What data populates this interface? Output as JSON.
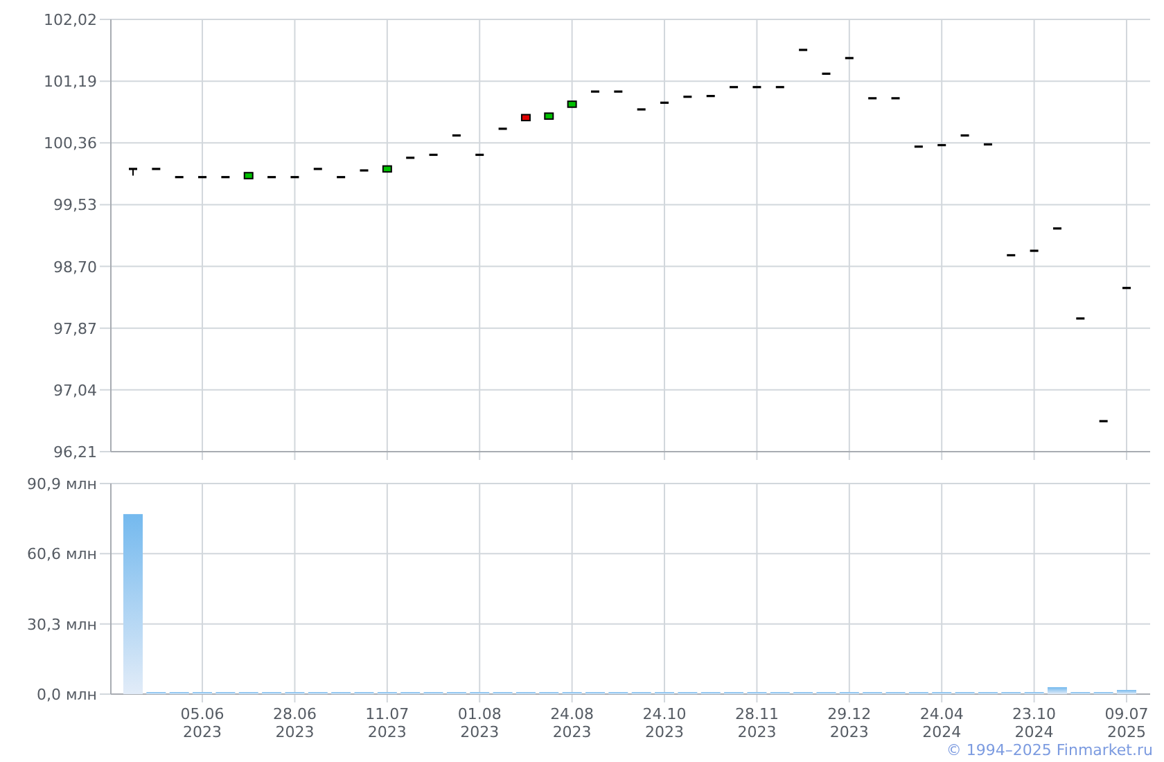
{
  "price_chart": {
    "chart_data": {
      "type": "candlestick",
      "grid": true,
      "categories": [
        null,
        null,
        null,
        null,
        null,
        null,
        null,
        null,
        null,
        null,
        null,
        null,
        null,
        null,
        null,
        null,
        null,
        null,
        null,
        null,
        null,
        null,
        null,
        null,
        null,
        null,
        null,
        null,
        null,
        null,
        null,
        null,
        null,
        null,
        null,
        null,
        null,
        null,
        null,
        null,
        null,
        null,
        null,
        null
      ],
      "ohlc": [
        [
          100.01,
          100.01,
          99.92,
          100.01
        ],
        [
          100.01,
          100.01,
          100.01,
          100.01
        ],
        [
          99.9,
          99.9,
          99.9,
          99.9
        ],
        [
          99.9,
          99.9,
          99.9,
          99.9
        ],
        [
          99.9,
          99.9,
          99.9,
          99.9
        ],
        [
          99.88,
          99.96,
          99.88,
          99.96
        ],
        [
          99.9,
          99.9,
          99.9,
          99.9
        ],
        [
          99.9,
          99.9,
          99.9,
          99.9
        ],
        [
          100.01,
          100.01,
          100.01,
          100.01
        ],
        [
          99.9,
          99.9,
          99.9,
          99.9
        ],
        [
          99.99,
          99.99,
          99.99,
          99.99
        ],
        [
          99.97,
          100.05,
          99.97,
          100.05
        ],
        [
          100.16,
          100.16,
          100.16,
          100.16
        ],
        [
          100.2,
          100.2,
          100.2,
          100.2
        ],
        [
          100.46,
          100.46,
          100.46,
          100.46
        ],
        [
          100.2,
          100.2,
          100.2,
          100.2
        ],
        [
          100.55,
          100.55,
          100.55,
          100.55
        ],
        [
          100.74,
          100.74,
          100.66,
          100.66
        ],
        [
          100.68,
          100.76,
          100.68,
          100.76
        ],
        [
          100.84,
          100.92,
          100.84,
          100.92
        ],
        [
          101.05,
          101.05,
          101.05,
          101.05
        ],
        [
          101.05,
          101.05,
          101.05,
          101.05
        ],
        [
          100.81,
          100.81,
          100.81,
          100.81
        ],
        [
          100.9,
          100.9,
          100.9,
          100.9
        ],
        [
          100.98,
          100.98,
          100.98,
          100.98
        ],
        [
          100.99,
          100.99,
          100.99,
          100.99
        ],
        [
          101.11,
          101.11,
          101.11,
          101.11
        ],
        [
          101.11,
          101.11,
          101.11,
          101.11
        ],
        [
          101.11,
          101.11,
          101.11,
          101.11
        ],
        [
          101.61,
          101.61,
          101.61,
          101.61
        ],
        [
          101.29,
          101.29,
          101.29,
          101.29
        ],
        [
          101.5,
          101.5,
          101.5,
          101.5
        ],
        [
          100.96,
          100.96,
          100.96,
          100.96
        ],
        [
          100.96,
          100.96,
          100.96,
          100.96
        ],
        [
          100.31,
          100.31,
          100.31,
          100.31
        ],
        [
          100.33,
          100.33,
          100.33,
          100.33
        ],
        [
          100.46,
          100.46,
          100.46,
          100.46
        ],
        [
          100.34,
          100.34,
          100.34,
          100.34
        ],
        [
          98.85,
          98.85,
          98.85,
          98.85
        ],
        [
          98.91,
          98.91,
          98.91,
          98.91
        ],
        [
          99.21,
          99.21,
          99.21,
          99.21
        ],
        [
          98.0,
          98.0,
          98.0,
          98.0
        ],
        [
          96.62,
          96.62,
          96.62,
          96.62
        ],
        [
          98.41,
          98.41,
          98.41,
          98.41
        ]
      ],
      "ylim": [
        96.21,
        102.02
      ],
      "yticks": [
        {
          "value": 102.02,
          "label": "102,02"
        },
        {
          "value": 101.19,
          "label": "101,19"
        },
        {
          "value": 100.36,
          "label": "100,36"
        },
        {
          "value": 99.53,
          "label": "99,53"
        },
        {
          "value": 98.7,
          "label": "98,70"
        },
        {
          "value": 97.87,
          "label": "97,87"
        },
        {
          "value": 97.04,
          "label": "97,04"
        },
        {
          "value": 96.21,
          "label": "96,21"
        }
      ]
    }
  },
  "volume_chart": {
    "chart_data": {
      "type": "bar",
      "grid": true,
      "categories": [
        null,
        null,
        null,
        "05.06 2023",
        null,
        null,
        null,
        "28.06 2023",
        null,
        null,
        null,
        "11.07 2023",
        null,
        null,
        null,
        "01.08 2023",
        null,
        null,
        null,
        "24.08 2023",
        null,
        null,
        null,
        "24.10 2023",
        null,
        null,
        null,
        "28.11 2023",
        null,
        null,
        null,
        "29.12 2023",
        null,
        null,
        null,
        "24.04 2024",
        null,
        null,
        null,
        "23.10 2024",
        null,
        null,
        null,
        "09.07 2025"
      ],
      "series": [
        {
          "color": "#74b9ee",
          "values": [
            77.7,
            0.5,
            0.5,
            0.5,
            0.5,
            0.5,
            0.5,
            0.5,
            0.5,
            0.5,
            0.5,
            0.5,
            0.5,
            0.5,
            0.5,
            0.5,
            0.5,
            0.5,
            0.5,
            0.5,
            0.5,
            0.5,
            0.5,
            0.5,
            0.5,
            0.5,
            0.5,
            0.5,
            0.5,
            0.5,
            0.5,
            0.5,
            0.5,
            0.5,
            0.5,
            0.5,
            0.5,
            0.5,
            0.5,
            0.5,
            3.0,
            0.5,
            0.5,
            1.8
          ]
        }
      ],
      "ylim": [
        0,
        90.9
      ],
      "yticks": [
        {
          "value": 90.9,
          "label": "90,9 млн"
        },
        {
          "value": 60.6,
          "label": "60,6 млн"
        },
        {
          "value": 30.3,
          "label": "30,3 млн"
        },
        {
          "value": 0,
          "label": "0,0 млн"
        }
      ]
    }
  },
  "copyright": "© 1994–2025 Finmarket.ru"
}
